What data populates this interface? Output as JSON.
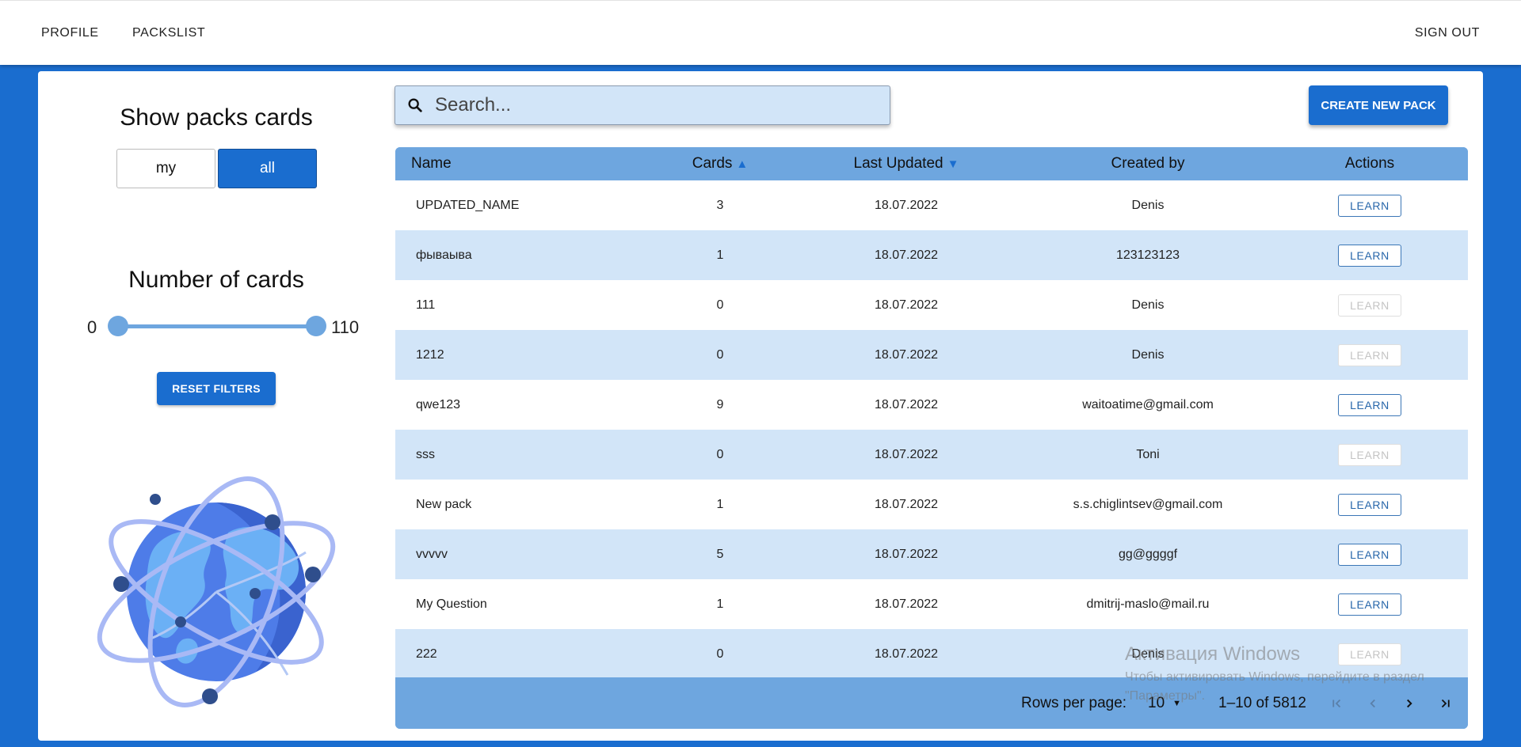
{
  "header": {
    "nav": {
      "profile": "PROFILE",
      "packslist": "PACKSLIST",
      "signout": "SIGN OUT"
    }
  },
  "sidebar": {
    "show_title": "Show packs cards",
    "toggle_my": "my",
    "toggle_all": "all",
    "toggle_selected": "all",
    "number_title": "Number of cards",
    "slider_min": "0",
    "slider_max": "110",
    "slider_value_low": 0,
    "slider_value_high": 110,
    "reset_label": "RESET FILTERS",
    "illustration_icon": "globe-network-icon"
  },
  "search": {
    "placeholder": "Search...",
    "value": ""
  },
  "create_button": "CREATE NEW PACK",
  "table": {
    "columns": {
      "name": "Name",
      "cards": "Cards",
      "updated": "Last Updated",
      "created": "Created by",
      "actions": "Actions"
    },
    "sort": {
      "cards": "asc",
      "updated": "desc"
    },
    "rows": [
      {
        "name": "UPDATED_NAME",
        "cards": "3",
        "updated": "18.07.2022",
        "created": "Denis",
        "action": "LEARN",
        "enabled": true
      },
      {
        "name": "фываыва",
        "cards": "1",
        "updated": "18.07.2022",
        "created": "123123123",
        "action": "LEARN",
        "enabled": true
      },
      {
        "name": "111",
        "cards": "0",
        "updated": "18.07.2022",
        "created": "Denis",
        "action": "LEARN",
        "enabled": false
      },
      {
        "name": "1212",
        "cards": "0",
        "updated": "18.07.2022",
        "created": "Denis",
        "action": "LEARN",
        "enabled": false
      },
      {
        "name": "qwe123",
        "cards": "9",
        "updated": "18.07.2022",
        "created": "waitoatime@gmail.com",
        "action": "LEARN",
        "enabled": true
      },
      {
        "name": "sss",
        "cards": "0",
        "updated": "18.07.2022",
        "created": "Toni",
        "action": "LEARN",
        "enabled": false
      },
      {
        "name": "New pack",
        "cards": "1",
        "updated": "18.07.2022",
        "created": "s.s.chiglintsev@gmail.com",
        "action": "LEARN",
        "enabled": true
      },
      {
        "name": "vvvvv",
        "cards": "5",
        "updated": "18.07.2022",
        "created": "gg@ggggf",
        "action": "LEARN",
        "enabled": true
      },
      {
        "name": "My Question",
        "cards": "1",
        "updated": "18.07.2022",
        "created": "dmitrij-maslo@mail.ru",
        "action": "LEARN",
        "enabled": true
      },
      {
        "name": "222",
        "cards": "0",
        "updated": "18.07.2022",
        "created": "Denis",
        "action": "LEARN",
        "enabled": false
      }
    ],
    "footer": {
      "rows_per_page_label": "Rows per page:",
      "rows_per_page": "10",
      "range": "1–10 of 5812"
    }
  },
  "watermark": {
    "title": "Активация Windows",
    "subtitle": "Чтобы активировать Windows, перейдите в раздел",
    "subtitle2": "\"Параметры\"."
  },
  "colors": {
    "primary": "#1a6dcf",
    "table_header": "#6ea6df",
    "row_alt": "#d2e5f8",
    "sort_arrow": "#1a6dcf"
  }
}
